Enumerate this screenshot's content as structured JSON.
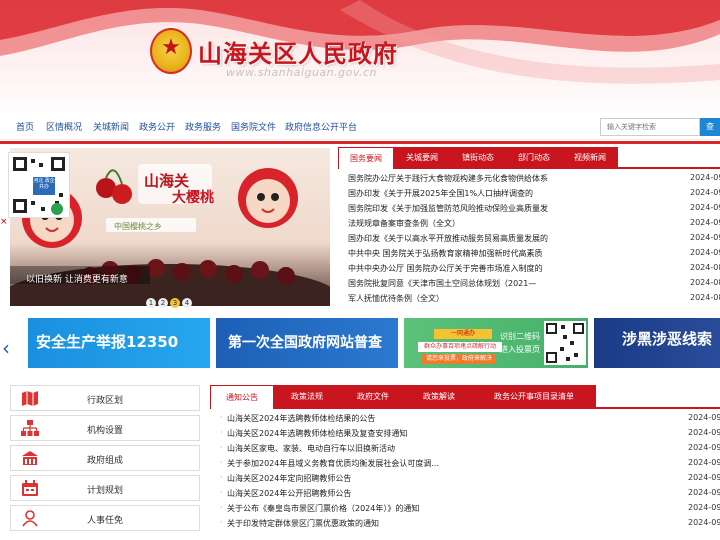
{
  "header": {
    "title": "山海关区人民政府",
    "url_watermark": "www.shanhaiguan.gov.cn"
  },
  "nav": {
    "items": [
      "首页",
      "区情概况",
      "关城新闻",
      "政务公开",
      "政务服务",
      "国务院文件",
      "政府信息公开平台"
    ],
    "search_placeholder": "输入关键字检索",
    "search_button": "查"
  },
  "slideshow": {
    "caption": "以旧换新 让消费更有新意",
    "image_text": [
      "山海关",
      "大樱桃",
      "中国樱桃之乡"
    ],
    "dots": [
      "1",
      "2",
      "3",
      "4"
    ],
    "active_dot": 3
  },
  "qr_widget": {
    "badge": "河北 政企共办",
    "close": "×"
  },
  "news": {
    "tabs": [
      "国务要闻",
      "关城要闻",
      "镇街动态",
      "部门动态",
      "视频新闻"
    ],
    "items": [
      {
        "title": "国务院办公厅关于践行大食物观构建多元化食物供给体系",
        "date": "2024-09"
      },
      {
        "title": "国办印发《关于开展2025年全国1%人口抽样调查的",
        "date": "2024-09"
      },
      {
        "title": "国务院印发《关于加强监管防范风险推动保险业高质量发",
        "date": "2024-09"
      },
      {
        "title": "法规规章备案审查条例（全文）",
        "date": "2024-09"
      },
      {
        "title": "国办印发《关于以高水平开放推动服务贸易高质量发展的",
        "date": "2024-09"
      },
      {
        "title": "中共中央 国务院关于弘扬教育家精神加强新时代高素质",
        "date": "2024-09"
      },
      {
        "title": "中共中央办公厅 国务院办公厅关于完善市场准入制度的",
        "date": "2024-08"
      },
      {
        "title": "国务院批复同意《天津市国土空间总体规划（2021—",
        "date": "2024-08"
      },
      {
        "title": "军人抚恤优待条例（全文）",
        "date": "2024-08"
      }
    ]
  },
  "promos": {
    "arrow": "‹",
    "a": "安全生产举报12350",
    "b": "第一次全国政府网站普查",
    "c_tag": "一网通办",
    "c_line1": "群众办事百项堵点疏解行动",
    "c_line2": "请您来投票，政府来解决",
    "c_qr_text": "识别二维码 进入投票页",
    "d": "涉黑涉恶线索"
  },
  "sidebar": {
    "items": [
      {
        "label": "行政区划",
        "icon": "map-icon"
      },
      {
        "label": "机构设置",
        "icon": "org-chart-icon"
      },
      {
        "label": "政府组成",
        "icon": "building-icon"
      },
      {
        "label": "计划规划",
        "icon": "calendar-icon"
      },
      {
        "label": "人事任免",
        "icon": "person-icon"
      }
    ]
  },
  "notices": {
    "tabs": [
      "通知公告",
      "政策法规",
      "政府文件",
      "政策解读",
      "政务公开事项目录清单"
    ],
    "items": [
      {
        "title": "山海关区2024年选聘教师体检结果的公告",
        "date": "2024-09-"
      },
      {
        "title": "山海关区2024年选聘教师体检结果及复查安排通知",
        "date": "2024-09-"
      },
      {
        "title": "山海关区家电、家装、电动自行车以旧换新活动",
        "date": "2024-09-"
      },
      {
        "title": "关于参加2024年县域义务教育优质均衡发展社会认可度调...",
        "date": "2024-09-"
      },
      {
        "title": "山海关区2024年定向招聘教师公告",
        "date": "2024-09-"
      },
      {
        "title": "山海关区2024年公开招聘教师公告",
        "date": "2024-09-"
      },
      {
        "title": "关于公布《秦皇岛市景区门票价格（2024年）》的通知",
        "date": "2024-09-"
      },
      {
        "title": "关于印发特定群体景区门票优惠政策的通知",
        "date": "2024-09-"
      }
    ]
  },
  "colors": {
    "brand_red": "#c9151e",
    "nav_blue": "#1f4e9c",
    "search_blue": "#1e86d6"
  }
}
